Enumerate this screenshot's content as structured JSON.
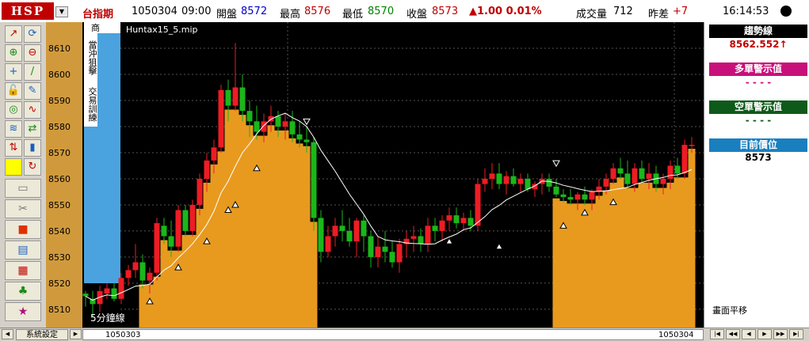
{
  "header": {
    "logo": "HSP",
    "symbol": "台指期",
    "date": "1050304",
    "time": "09:00",
    "open_label": "開盤",
    "open_value": "8572",
    "high_label": "最高",
    "high_value": "8576",
    "low_label": "最低",
    "low_value": "8570",
    "close_label": "收盤",
    "close_value": "8573",
    "change": "▲1.00 0.01%",
    "volume_label": "成交量",
    "volume_value": "712",
    "diff_label": "昨差",
    "diff_value": "+7",
    "clock": "16:14:53"
  },
  "chart": {
    "file_label": "Huntax15_5.mip",
    "period_label": "5分鐘線",
    "side_labels": [
      "商",
      "當沖狙擊",
      "交易訓練"
    ],
    "date_left": "1050303",
    "date_right": "1050304"
  },
  "colors": {
    "up": "#ee1c24",
    "down": "#1ab71a",
    "band": "#e89a1f",
    "blue": "#4aa3df",
    "price_axis": "#d09a3c",
    "trend": "#000000",
    "long": "#c8107a",
    "short": "#0e5a1a",
    "current": "#1a7fbf"
  },
  "chart_data": {
    "type": "candlestick",
    "ylim": [
      8503,
      8620
    ],
    "yticks": [
      8510,
      8520,
      8530,
      8540,
      8550,
      8560,
      8570,
      8580,
      8590,
      8600,
      8610
    ],
    "candles": [
      [
        8516,
        8517,
        8511,
        8515
      ],
      [
        8514,
        8517,
        8507,
        8512
      ],
      [
        8512,
        8519,
        8509,
        8517
      ],
      [
        8516,
        8520,
        8514,
        8518
      ],
      [
        8518,
        8520,
        8513,
        8514
      ],
      [
        8514,
        8524,
        8512,
        8522
      ],
      [
        8522,
        8527,
        8519,
        8525
      ],
      [
        8525,
        8535,
        8522,
        8528
      ],
      [
        8528,
        8531,
        8518,
        8521
      ],
      [
        8521,
        8526,
        8516,
        8524
      ],
      [
        8524,
        8545,
        8521,
        8543
      ],
      [
        8542,
        8545,
        8535,
        8538
      ],
      [
        8538,
        8544,
        8530,
        8534
      ],
      [
        8534,
        8550,
        8532,
        8548
      ],
      [
        8548,
        8550,
        8538,
        8540
      ],
      [
        8540,
        8552,
        8538,
        8550
      ],
      [
        8550,
        8562,
        8546,
        8560
      ],
      [
        8560,
        8570,
        8555,
        8567
      ],
      [
        8567,
        8575,
        8562,
        8572
      ],
      [
        8572,
        8596,
        8570,
        8594
      ],
      [
        8594,
        8598,
        8582,
        8588
      ],
      [
        8588,
        8612,
        8586,
        8595
      ],
      [
        8595,
        8600,
        8582,
        8586
      ],
      [
        8586,
        8590,
        8576,
        8582
      ],
      [
        8582,
        8588,
        8575,
        8578
      ],
      [
        8578,
        8585,
        8574,
        8582
      ],
      [
        8582,
        8588,
        8578,
        8584
      ],
      [
        8584,
        8586,
        8576,
        8580
      ],
      [
        8580,
        8585,
        8575,
        8582
      ],
      [
        8582,
        8586,
        8574,
        8577
      ],
      [
        8577,
        8582,
        8572,
        8575
      ],
      [
        8575,
        8580,
        8570,
        8574
      ],
      [
        8574,
        8576,
        8540,
        8545
      ],
      [
        8545,
        8548,
        8528,
        8532
      ],
      [
        8532,
        8542,
        8530,
        8538
      ],
      [
        8538,
        8545,
        8534,
        8542
      ],
      [
        8542,
        8548,
        8536,
        8540
      ],
      [
        8540,
        8545,
        8534,
        8536
      ],
      [
        8536,
        8545,
        8530,
        8544
      ],
      [
        8544,
        8546,
        8532,
        8538
      ],
      [
        8538,
        8540,
        8526,
        8530
      ],
      [
        8530,
        8538,
        8526,
        8534
      ],
      [
        8534,
        8540,
        8528,
        8532
      ],
      [
        8532,
        8536,
        8526,
        8528
      ],
      [
        8528,
        8537,
        8524,
        8535
      ],
      [
        8535,
        8540,
        8530,
        8537
      ],
      [
        8537,
        8542,
        8532,
        8538
      ],
      [
        8538,
        8541,
        8532,
        8535
      ],
      [
        8535,
        8545,
        8532,
        8542
      ],
      [
        8542,
        8545,
        8536,
        8540
      ],
      [
        8540,
        8546,
        8536,
        8544
      ],
      [
        8544,
        8549,
        8540,
        8546
      ],
      [
        8546,
        8549,
        8541,
        8543
      ],
      [
        8543,
        8547,
        8540,
        8545
      ],
      [
        8545,
        8548,
        8540,
        8542
      ],
      [
        8542,
        8560,
        8540,
        8558
      ],
      [
        8558,
        8564,
        8555,
        8560
      ],
      [
        8560,
        8566,
        8556,
        8562
      ],
      [
        8562,
        8566,
        8556,
        8558
      ],
      [
        8558,
        8563,
        8554,
        8561
      ],
      [
        8561,
        8564,
        8557,
        8558
      ],
      [
        8558,
        8562,
        8555,
        8560
      ],
      [
        8560,
        8562,
        8555,
        8556
      ],
      [
        8556,
        8559,
        8553,
        8558
      ],
      [
        8558,
        8562,
        8554,
        8560
      ],
      [
        8560,
        8562,
        8555,
        8557
      ],
      [
        8557,
        8560,
        8553,
        8554
      ],
      [
        8554,
        8556,
        8551,
        8553
      ],
      [
        8553,
        8556,
        8550,
        8552
      ],
      [
        8552,
        8555,
        8548,
        8554
      ],
      [
        8554,
        8557,
        8550,
        8552
      ],
      [
        8552,
        8556,
        8548,
        8555
      ],
      [
        8555,
        8560,
        8552,
        8557
      ],
      [
        8557,
        8562,
        8554,
        8560
      ],
      [
        8560,
        8566,
        8558,
        8564
      ],
      [
        8564,
        8568,
        8560,
        8562
      ],
      [
        8562,
        8567,
        8556,
        8558
      ],
      [
        8558,
        8566,
        8555,
        8564
      ],
      [
        8564,
        8567,
        8558,
        8560
      ],
      [
        8560,
        8566,
        8556,
        8562
      ],
      [
        8562,
        8565,
        8555,
        8558
      ],
      [
        8558,
        8562,
        8554,
        8560
      ],
      [
        8560,
        8567,
        8556,
        8565
      ],
      [
        8565,
        8568,
        8560,
        8562
      ],
      [
        8562,
        8575,
        8560,
        8573
      ],
      [
        8573,
        8576,
        8570,
        8573
      ]
    ]
  },
  "right_panel": {
    "trend_title": "趨勢線",
    "trend_value": "8562.552↑",
    "long_title": "多單警示值",
    "long_value": "- - - -",
    "short_title": "空單警示值",
    "short_value": "- - - -",
    "current_title": "目前價位",
    "current_value": "8573",
    "pan_label": "畫面平移"
  },
  "statusbar": {
    "left_arrow": "◀",
    "settings_label": "系統設定",
    "right_arrow": "▶",
    "nav": [
      "|◀",
      "◀◀",
      "◀",
      "▶",
      "▶▶",
      "▶|"
    ]
  },
  "toolbar": {
    "icons": [
      "draw-line-icon",
      "magnet-icon",
      "zoom-in-icon",
      "zoom-out-icon",
      "crosshair-icon",
      "pen-icon",
      "unlock-icon",
      "pencil-icon",
      "target-icon",
      "wave-icon",
      "stats-icon",
      "swap-icon",
      "order-icon",
      "candle-icon",
      "yellow-square-icon",
      "refresh-icon"
    ],
    "glyphs": [
      "↗",
      "⟳",
      "⊕",
      "⊖",
      "+",
      "/",
      "🔓",
      "✎",
      "◎",
      "∿",
      "≋",
      "⇄",
      "⇅",
      "▮",
      "",
      "↻"
    ],
    "wide_icons": [
      "folder-icon",
      "scissors-icon",
      "stop-icon",
      "report-icon",
      "grid-icon",
      "gloves-icon",
      "logo-icon"
    ],
    "wide_glyphs": [
      "▭",
      "✂",
      "■",
      "▤",
      "▦",
      "♣",
      "★"
    ]
  }
}
